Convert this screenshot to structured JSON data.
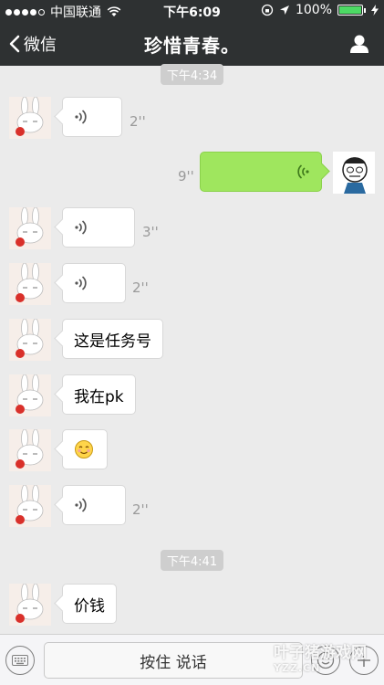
{
  "status_bar": {
    "carrier": "中国联通",
    "time": "下午6:09",
    "battery": "100%",
    "signal_bars": 4
  },
  "nav": {
    "back_label": "微信",
    "title": "珍惜青春。",
    "back_icon": "chevron-left-icon",
    "profile_icon": "person-icon"
  },
  "timestamps": [
    "下午4:34",
    "下午4:41"
  ],
  "messages": [
    {
      "type": "voice",
      "side": "left",
      "duration": "2''"
    },
    {
      "type": "voice",
      "side": "right",
      "duration": "9''"
    },
    {
      "type": "voice",
      "side": "left",
      "duration": "3''"
    },
    {
      "type": "voice",
      "side": "left",
      "duration": "2''"
    },
    {
      "type": "text",
      "side": "left",
      "text": "这是任务号"
    },
    {
      "type": "text",
      "side": "left",
      "text": "我在pk"
    },
    {
      "type": "emoji",
      "side": "left",
      "emoji": "😊"
    },
    {
      "type": "voice",
      "side": "left",
      "duration": "2''"
    },
    {
      "type": "text",
      "side": "left",
      "text": "价钱"
    }
  ],
  "input_bar": {
    "talk_label": "按住 说话",
    "keyboard_icon": "keyboard-icon",
    "emoji_icon": "emoji-icon",
    "plus_icon": "plus-icon"
  },
  "watermark": {
    "text": "叶子猪游戏网",
    "url": "YZZ.CN"
  },
  "colors": {
    "nav_bg": "#2e3132",
    "chat_bg": "#ebebeb",
    "outgoing_bubble": "#9fe65e",
    "incoming_bubble": "#ffffff"
  }
}
